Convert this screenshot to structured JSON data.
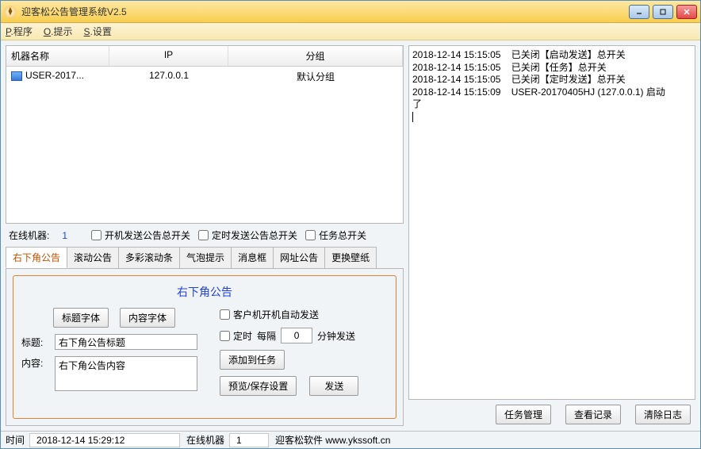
{
  "window": {
    "title": "迎客松公告管理系统V2.5"
  },
  "menu": {
    "program": "程序",
    "program_u": "P",
    "tip": "提示",
    "tip_u": "O",
    "setting": "设置",
    "setting_u": "S"
  },
  "table": {
    "headers": {
      "name": "机器名称",
      "ip": "IP",
      "group": "分组"
    },
    "row": {
      "name": "USER-2017...",
      "ip": "127.0.0.1",
      "group": "默认分组"
    }
  },
  "online": {
    "label": "在线机器:",
    "count": "1"
  },
  "switches": {
    "boot": "开机发送公告总开关",
    "timer": "定时发送公告总开关",
    "task": "任务总开关"
  },
  "tabs": [
    "右下角公告",
    "滚动公告",
    "多彩滚动条",
    "气泡提示",
    "消息框",
    "网址公告",
    "更换壁纸"
  ],
  "panel": {
    "title": "右下角公告",
    "title_font_btn": "标题字体",
    "content_font_btn": "内容字体",
    "title_label": "标题:",
    "title_value": "右下角公告标题",
    "content_label": "内容:",
    "content_value": "右下角公告内容",
    "auto_send": "客户机开机自动发送",
    "timer_lbl": "定时",
    "every_lbl": "每隔",
    "timer_val": "0",
    "min_send": "分钟发送",
    "add_task": "添加到任务",
    "preview": "预览/保存设置",
    "send": "发送"
  },
  "log": "2018-12-14 15:15:05    已关闭【启动发送】总开关\n2018-12-14 15:15:05    已关闭【任务】总开关\n2018-12-14 15:15:05    已关闭【定时发送】总开关\n2018-12-14 15:15:09    USER-20170405HJ (127.0.0.1) 启动\n了",
  "right_btns": {
    "task_mgr": "任务管理",
    "view_log": "查看记录",
    "clear_log": "清除日志"
  },
  "status": {
    "time_lbl": "时间",
    "time_val": "2018-12-14 15:29:12",
    "online_lbl": "在线机器",
    "online_val": "1",
    "soft": "迎客松软件 www.ykssoft.cn"
  }
}
